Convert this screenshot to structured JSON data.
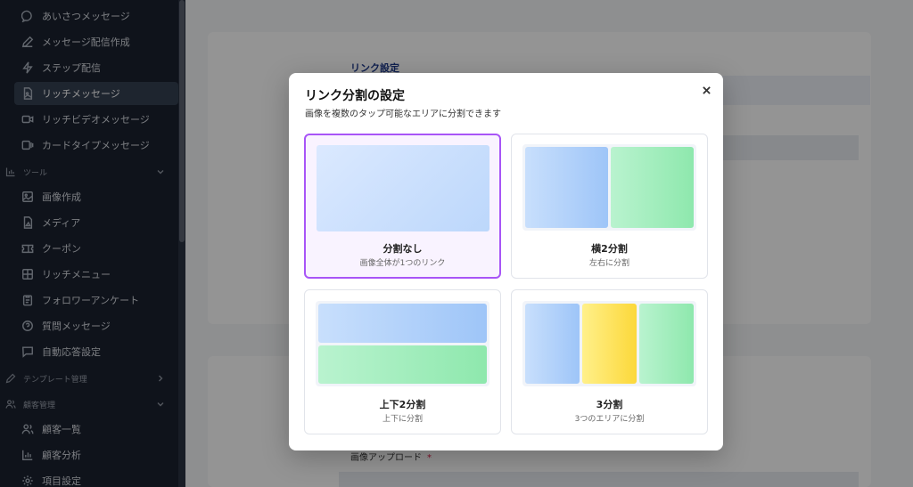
{
  "sidebar": {
    "items": [
      {
        "label": "あいさつメッセージ",
        "icon": "chat-bubble-icon"
      },
      {
        "label": "メッセージ配信作成",
        "icon": "pencil-icon"
      },
      {
        "label": "ステップ配信",
        "icon": "lightning-icon"
      },
      {
        "label": "リッチメッセージ",
        "icon": "image-file-icon"
      },
      {
        "label": "リッチビデオメッセージ",
        "icon": "video-icon"
      },
      {
        "label": "カードタイプメッセージ",
        "icon": "cards-icon"
      }
    ],
    "active_item": "リッチメッセージ",
    "tools_section": {
      "label": "ツール",
      "icon": "bar-chart-icon"
    },
    "tools_items": [
      {
        "label": "画像作成",
        "icon": "image-icon"
      },
      {
        "label": "メディア",
        "icon": "media-file-icon"
      },
      {
        "label": "クーポン",
        "icon": "ticket-icon"
      },
      {
        "label": "リッチメニュー",
        "icon": "grid-icon"
      },
      {
        "label": "フォロワーアンケート",
        "icon": "clipboard-icon"
      },
      {
        "label": "質問メッセージ",
        "icon": "question-icon"
      },
      {
        "label": "自動応答設定",
        "icon": "message-square-icon"
      }
    ],
    "template_section": {
      "label": "テンプレート管理",
      "icon": "pen-icon"
    },
    "customer_section": {
      "label": "顧客管理",
      "icon": "users-icon"
    },
    "customer_items": [
      {
        "label": "顧客一覧",
        "icon": "users-icon"
      },
      {
        "label": "顧客分析",
        "icon": "chart-icon"
      },
      {
        "label": "項目設定",
        "icon": "gear-icon"
      }
    ]
  },
  "background_page": {
    "section_title": "リンク設定",
    "upload_label": "画像アップロード",
    "required_mark": "*"
  },
  "modal": {
    "title": "リンク分割の設定",
    "subtitle": "画像を複数のタップ可能なエリアに分割できます",
    "options": [
      {
        "name": "分割なし",
        "desc": "画像全体が1つのリンク",
        "selected": true
      },
      {
        "name": "横2分割",
        "desc": "左右に分割",
        "selected": false
      },
      {
        "name": "上下2分割",
        "desc": "上下に分割",
        "selected": false
      },
      {
        "name": "3分割",
        "desc": "3つのエリアに分割",
        "selected": false
      }
    ]
  },
  "colors": {
    "sidebar_bg": "#1b2230",
    "selected_border": "#a855f7",
    "accent_title": "#1e3a8a"
  }
}
